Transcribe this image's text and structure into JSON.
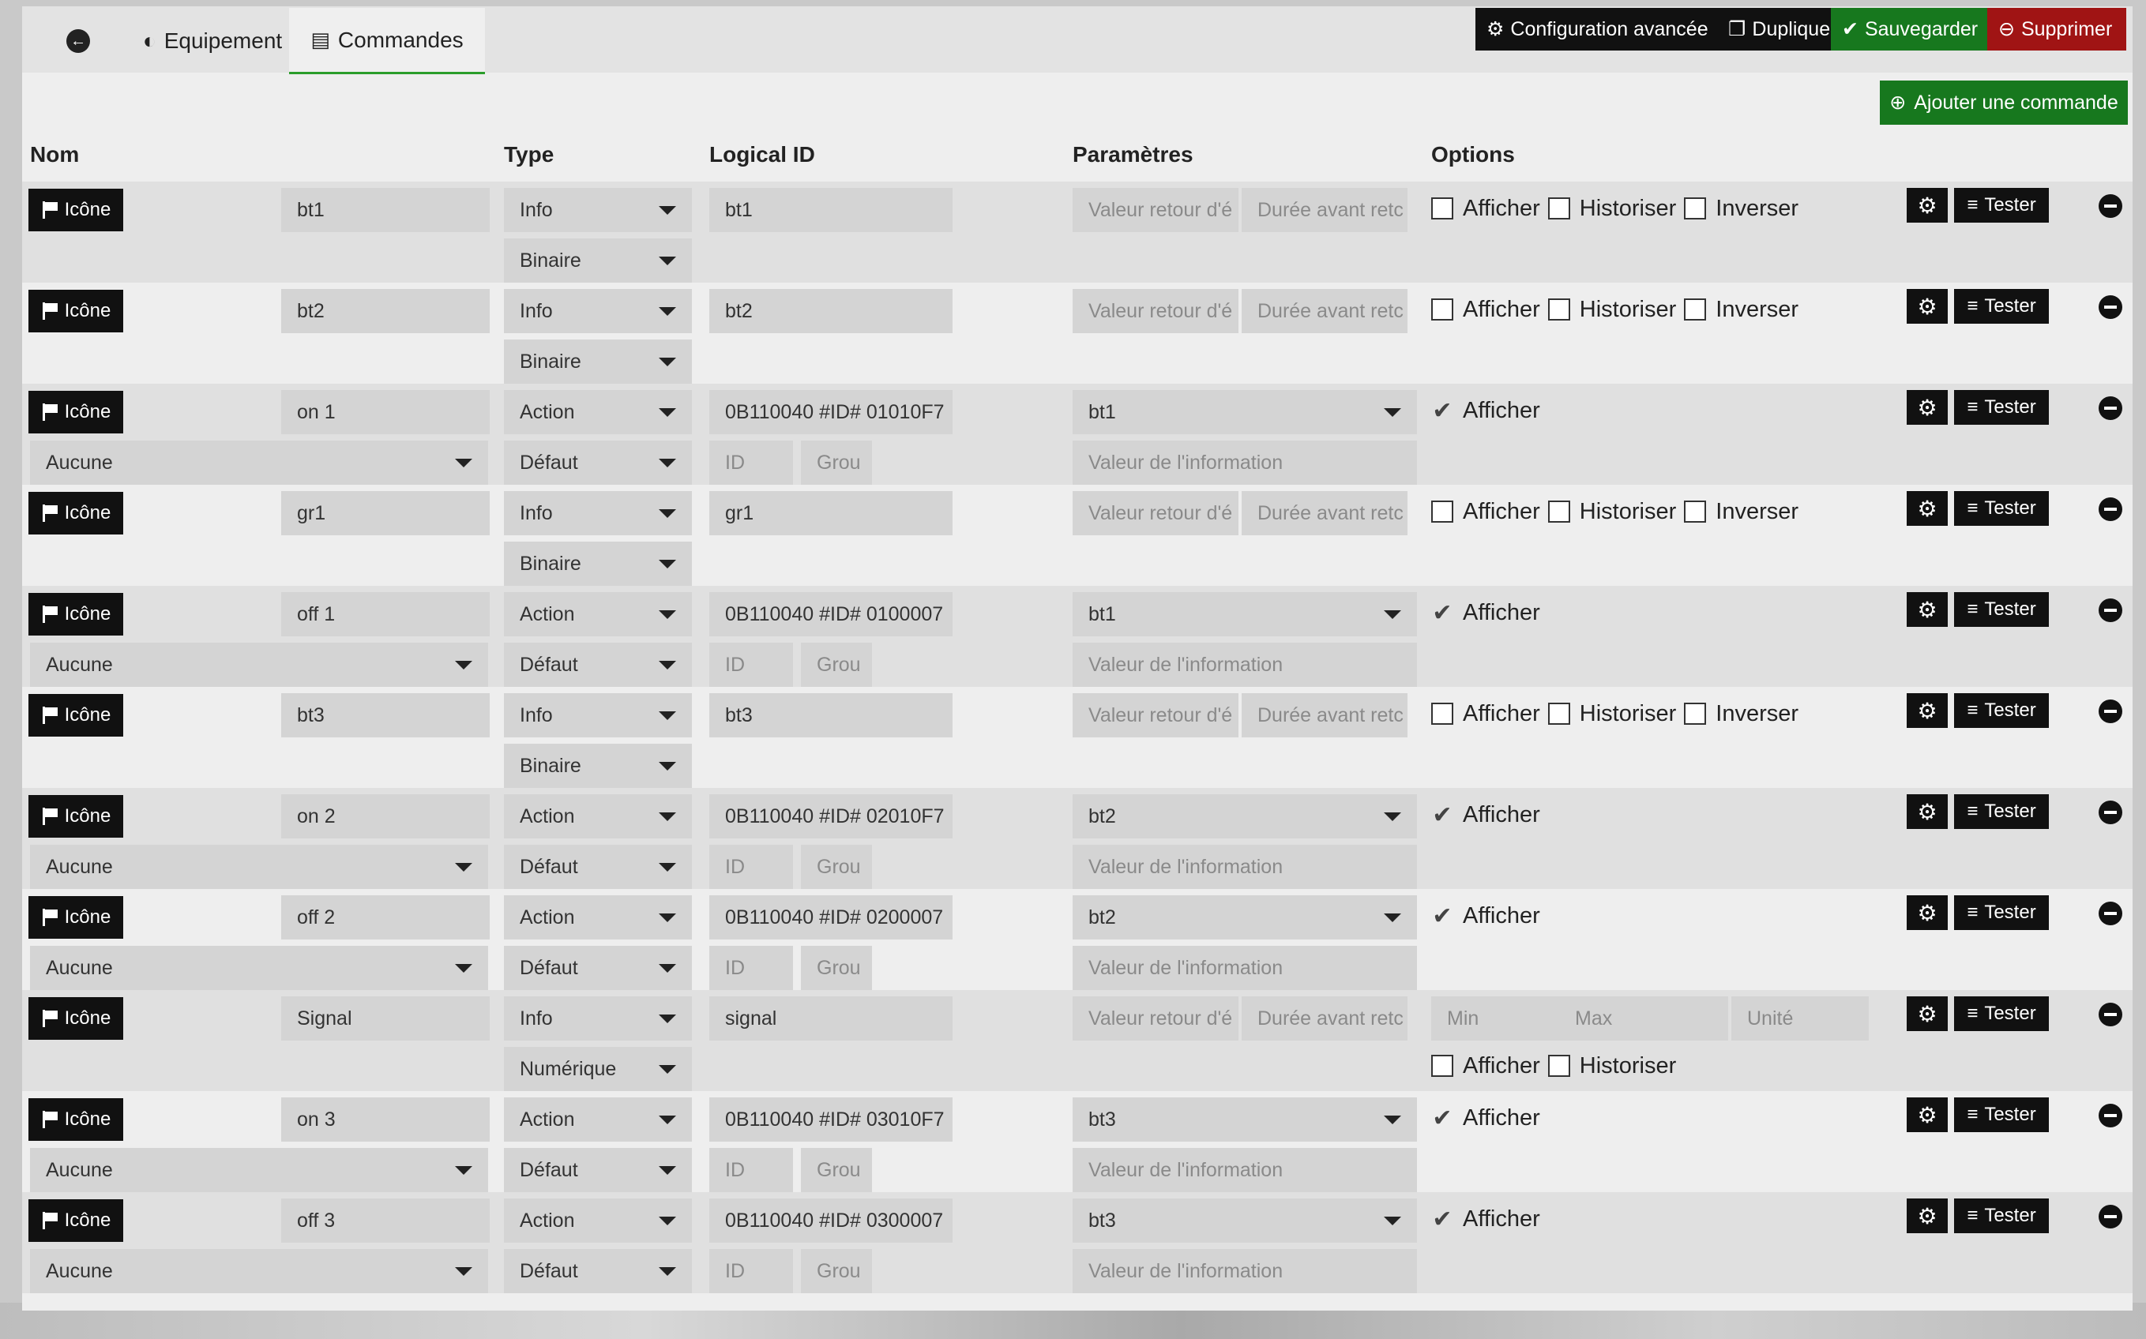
{
  "tabs": {
    "back_icon": "arrow-left-icon",
    "equipement": "Equipement",
    "commandes": "Commandes"
  },
  "toolbar": {
    "config": "Configuration avancée",
    "dupliquer": "Dupliquer",
    "sauvegarder": "Sauvegarder",
    "supprimer": "Supprimer",
    "colors": {
      "black": "#111111",
      "green": "#17781e",
      "red": "#a01414"
    }
  },
  "add_command": "Ajouter une commande",
  "columns": {
    "nom": "Nom",
    "type": "Type",
    "logical_id": "Logical ID",
    "parametres": "Paramètres",
    "options": "Options"
  },
  "labels": {
    "icone": "Icône",
    "tester": "Tester",
    "afficher": "Afficher",
    "historiser": "Historiser",
    "inverser": "Inverser",
    "valeur_retour_ph": "Valeur retour d'é",
    "duree_ph": "Durée avant retc",
    "valeur_info_ph": "Valeur de l'information",
    "id_ph": "ID",
    "grou_ph": "Grou",
    "min_ph": "Min",
    "max_ph": "Max",
    "unite_ph": "Unité"
  },
  "rows": [
    {
      "name": "bt1",
      "type": "Info",
      "subtype": "Binaire",
      "logical_id": "bt1",
      "kind": "info",
      "afficher": false,
      "historiser": false,
      "inverser": false
    },
    {
      "name": "bt2",
      "type": "Info",
      "subtype": "Binaire",
      "logical_id": "bt2",
      "kind": "info",
      "afficher": false,
      "historiser": false,
      "inverser": false
    },
    {
      "name": "on 1",
      "type": "Action",
      "subtype": "Défaut",
      "logical_id": "0B110040 #ID# 01010F7",
      "kind": "action",
      "value_select": "bt1",
      "generic": "Aucune",
      "afficher": true
    },
    {
      "name": "gr1",
      "type": "Info",
      "subtype": "Binaire",
      "logical_id": "gr1",
      "kind": "info",
      "afficher": false,
      "historiser": false,
      "inverser": false
    },
    {
      "name": "off 1",
      "type": "Action",
      "subtype": "Défaut",
      "logical_id": "0B110040 #ID# 0100007",
      "kind": "action",
      "value_select": "bt1",
      "generic": "Aucune",
      "afficher": true
    },
    {
      "name": "bt3",
      "type": "Info",
      "subtype": "Binaire",
      "logical_id": "bt3",
      "kind": "info",
      "afficher": false,
      "historiser": false,
      "inverser": false
    },
    {
      "name": "on 2",
      "type": "Action",
      "subtype": "Défaut",
      "logical_id": "0B110040 #ID# 02010F7",
      "kind": "action",
      "value_select": "bt2",
      "generic": "Aucune",
      "afficher": true
    },
    {
      "name": "off 2",
      "type": "Action",
      "subtype": "Défaut",
      "logical_id": "0B110040 #ID# 0200007",
      "kind": "action",
      "value_select": "bt2",
      "generic": "Aucune",
      "afficher": true
    },
    {
      "name": "Signal",
      "type": "Info",
      "subtype": "Numérique",
      "logical_id": "signal",
      "kind": "numeric",
      "afficher": false,
      "historiser": false
    },
    {
      "name": "on 3",
      "type": "Action",
      "subtype": "Défaut",
      "logical_id": "0B110040 #ID# 03010F7",
      "kind": "action",
      "value_select": "bt3",
      "generic": "Aucune",
      "afficher": true
    },
    {
      "name": "off 3",
      "type": "Action",
      "subtype": "Défaut",
      "logical_id": "0B110040 #ID# 0300007",
      "kind": "action",
      "value_select": "bt3",
      "generic": "Aucune",
      "afficher": true
    }
  ]
}
